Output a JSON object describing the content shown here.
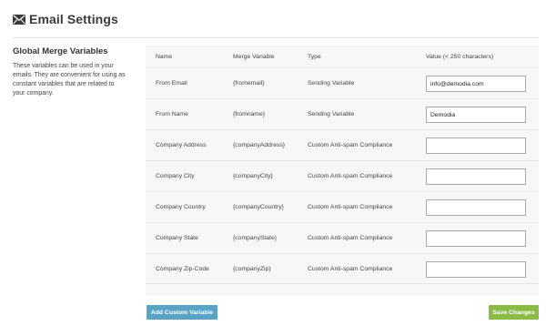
{
  "header": {
    "title": "Email Settings",
    "icon": "envelope-icon"
  },
  "sidebar": {
    "title": "Global Merge Variables",
    "description_lines": [
      "These variables can be used in your",
      "emails. They are convenient for using as",
      "constant variables that are related to",
      "your company."
    ]
  },
  "table": {
    "columns": [
      "Name",
      "Merge Variable",
      "Type",
      "Value (< 250 characters)"
    ],
    "rows": [
      {
        "name": "From Email",
        "merge": "{fromemail}",
        "type": "Sending Variable",
        "value": "info@demodia.com"
      },
      {
        "name": "From Name",
        "merge": "{fromname}",
        "type": "Sending Variable",
        "value": "Demodia"
      },
      {
        "name": "Company Address",
        "merge": "{companyAddress}",
        "type": "Custom Anti-spam Compliance",
        "value": ""
      },
      {
        "name": "Company City",
        "merge": "{companyCity}",
        "type": "Custom Anti-spam Compliance",
        "value": ""
      },
      {
        "name": "Company Country",
        "merge": "{companyCountry}",
        "type": "Custom Anti-spam Compliance",
        "value": ""
      },
      {
        "name": "Company State",
        "merge": "{companyState}",
        "type": "Custom Anti-spam Compliance",
        "value": ""
      },
      {
        "name": "Company Zip-Code",
        "merge": "{companyZip}",
        "type": "Custom Anti-spam Compliance",
        "value": ""
      }
    ]
  },
  "buttons": {
    "add_label": "Add Custom Variable",
    "save_label": "Save Changes"
  },
  "colors": {
    "add_button": "#5ba3c4",
    "save_button": "#8cbb45",
    "panel_bg": "#f7f7f7"
  }
}
